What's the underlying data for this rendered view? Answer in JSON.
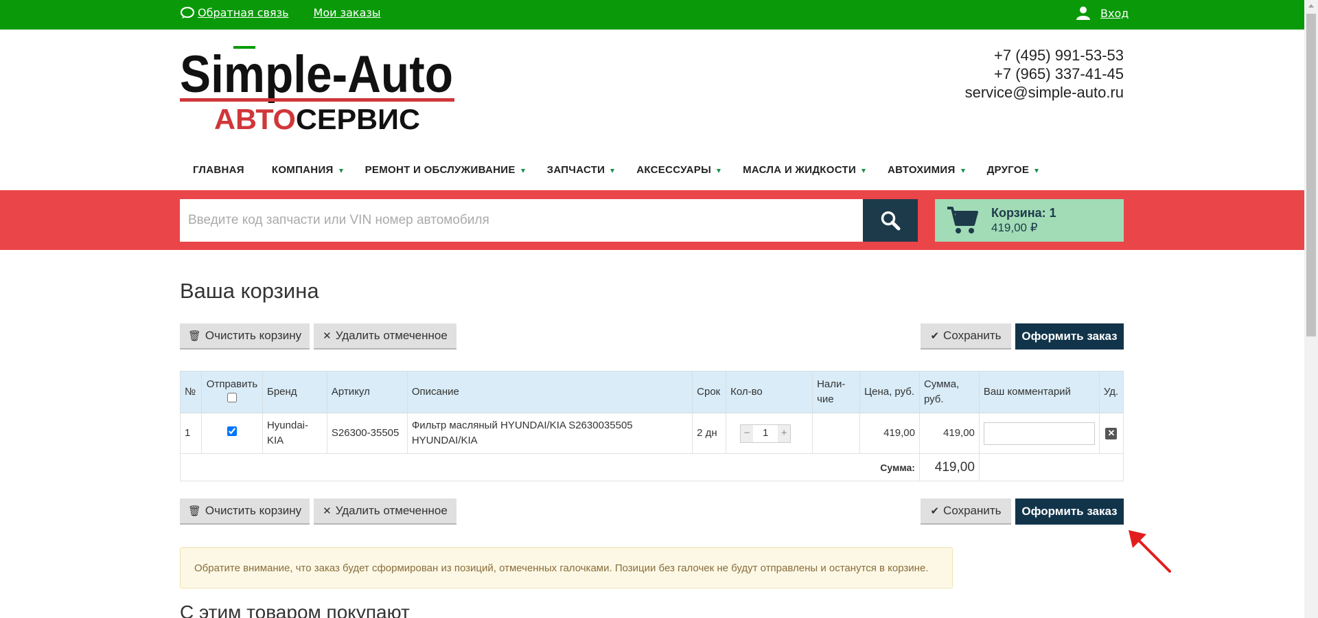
{
  "topbar": {
    "feedback": "Обратная связь",
    "orders": "Мои заказы",
    "login": "Вход"
  },
  "logo": {
    "line1": "Simple-Auto",
    "line2a": "АВТО",
    "line2b": "СЕРВИС"
  },
  "contacts": {
    "phone1": "+7 (495) 991-53-53",
    "phone2": "+7 (965) 337-41-45",
    "email": "service@simple-auto.ru"
  },
  "nav": {
    "items": [
      {
        "label": "ГЛАВНАЯ"
      },
      {
        "label": "КОМПАНИЯ"
      },
      {
        "label": "РЕМОНТ И ОБСЛУЖИВАНИЕ"
      },
      {
        "label": "ЗАПЧАСТИ"
      },
      {
        "label": "АКСЕССУАРЫ"
      },
      {
        "label": "МАСЛА И ЖИДКОСТИ"
      },
      {
        "label": "АВТОХИМИЯ"
      },
      {
        "label": "ДРУГОЕ"
      }
    ]
  },
  "search": {
    "placeholder": "Введите код запчасти или VIN номер автомобиля"
  },
  "cart": {
    "title": "Корзина: 1",
    "total": "419,00 ₽"
  },
  "page": {
    "title": "Ваша корзина",
    "clear_label": "Очистить корзину",
    "delete_label": "Удалить отмеченное",
    "save_label": "Сохранить",
    "checkout_label": "Оформить заказ",
    "notice": "Обратите внимание, что заказ будет сформирован из позиций, отмеченных галочками. Позиции без галочек не будут отправлены и останутся в корзине.",
    "related_title": "С этим товаром покупают"
  },
  "table": {
    "headers": {
      "num": "№",
      "send": "Отправить",
      "brand": "Бренд",
      "article": "Артикул",
      "description": "Описание",
      "term": "Срок",
      "qty": "Кол-во",
      "avail1": "Нали-",
      "avail2": "чие",
      "price": "Цена, руб.",
      "sum1": "Сумма,",
      "sum2": "руб.",
      "comment": "Ваш комментарий",
      "del": "Уд."
    },
    "rows": [
      {
        "num": "1",
        "brand1": "Hyundai-",
        "brand2": "KIA",
        "article": "S26300-35505",
        "desc1": "Фильтр масляный HYUNDAI/KIA S2630035505",
        "desc2": "HYUNDAI/KIA",
        "term": "2 дн",
        "qty": "1",
        "price": "419,00",
        "sum": "419,00"
      }
    ],
    "total_label": "Сумма:",
    "total_value": "419,00"
  },
  "colors": {
    "topbar": "#0a9a09",
    "band": "#ea4549",
    "dark": "#12344a",
    "cart": "#a1dcb6"
  }
}
